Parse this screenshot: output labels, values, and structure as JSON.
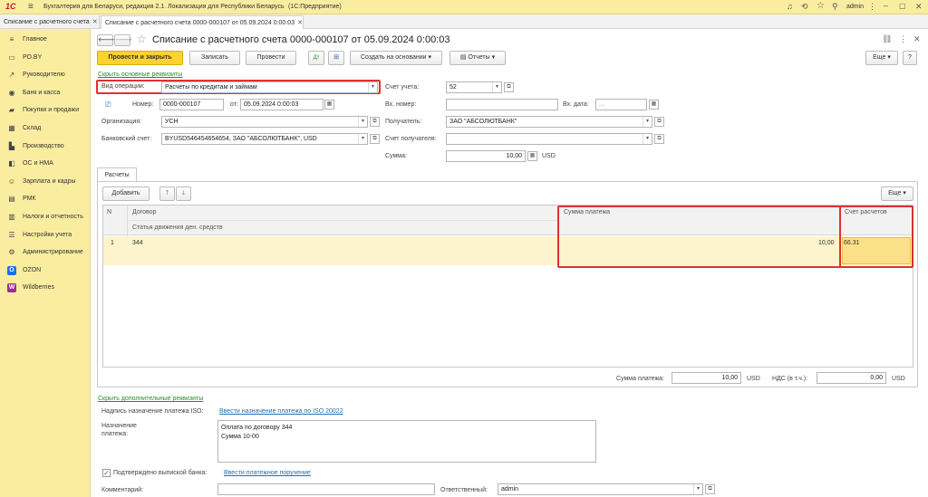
{
  "topbar": {
    "logo": "1С",
    "title": "Бухгалтерия для Беларуси, редакция 2.1. Локализация для Республики Беларусь",
    "platform": "(1С:Предприятие)",
    "user": "admin"
  },
  "tabs": [
    {
      "label": "Списание с расчетного счета"
    },
    {
      "label": "Списание с расчетного счета 0000-000107 от 05.09.2024 0:00:03"
    }
  ],
  "sidebar": {
    "items": [
      {
        "label": "Главное",
        "icon": "menu-icon",
        "glyph": "≡"
      },
      {
        "label": "РО.BY",
        "icon": "ro-icon",
        "glyph": "▭"
      },
      {
        "label": "Руководителю",
        "icon": "chart-icon",
        "glyph": "↗"
      },
      {
        "label": "Банк и касса",
        "icon": "bank-icon",
        "glyph": "◉"
      },
      {
        "label": "Покупки и продажи",
        "icon": "cart-icon",
        "glyph": "▰"
      },
      {
        "label": "Склад",
        "icon": "warehouse-icon",
        "glyph": "▦"
      },
      {
        "label": "Производство",
        "icon": "factory-icon",
        "glyph": "▙"
      },
      {
        "label": "ОС и НМА",
        "icon": "assets-icon",
        "glyph": "◧"
      },
      {
        "label": "Зарплата и кадры",
        "icon": "people-icon",
        "glyph": "☺"
      },
      {
        "label": "РМК",
        "icon": "cash-register-icon",
        "glyph": "▤"
      },
      {
        "label": "Налоги и отчетность",
        "icon": "taxes-icon",
        "glyph": "▥"
      },
      {
        "label": "Настройки учета",
        "icon": "settings-icon",
        "glyph": "☰"
      },
      {
        "label": "Администрирование",
        "icon": "gear-icon",
        "glyph": "⚙"
      },
      {
        "label": "OZON",
        "icon": "ozon-icon",
        "glyph": "O"
      },
      {
        "label": "Wildberries",
        "icon": "wildberries-icon",
        "glyph": "W"
      }
    ]
  },
  "doc": {
    "title": "Списание с расчетного счета 0000-000107 от 05.09.2024 0:00:03"
  },
  "toolbar": {
    "post_close": "Провести и закрыть",
    "save": "Записать",
    "post": "Провести",
    "create_based": "Создать на основании",
    "reports": "Отчеты",
    "more": "Еще"
  },
  "form": {
    "hide_main_link": "Скрыть основные реквизиты",
    "operation_label": "Вид операции:",
    "operation_value": "Расчеты по кредитам и займам",
    "number_label": "Номер:",
    "number_value": "0000-000107",
    "from_label": "от:",
    "date_value": "05.09.2024  0:00:03",
    "org_label": "Организация:",
    "org_value": "УСН",
    "bank_account_label": "Банковский счет:",
    "bank_account_value": "BYUSD546454654654, ЗАО \"АБСОЛЮТБАНК\", USD",
    "account_label": "Счет учета:",
    "account_value": "52",
    "in_number_label": "Вх. номер:",
    "in_number_value": "",
    "in_date_label": "Вх. дата:",
    "in_date_value": " .  .",
    "recipient_label": "Получатель:",
    "recipient_value": "ЗАО \"АБСОЛЮТБАНК\"",
    "recipient_account_label": "Счет получателя:",
    "recipient_account_value": "",
    "sum_label": "Сумма:",
    "sum_value": "10,00",
    "currency": "USD"
  },
  "payments": {
    "tab_label": "Расчеты",
    "add": "Добавить",
    "more": "Еще",
    "columns": {
      "n": "N",
      "contract": "Договор",
      "cashflow": "Статья движения ден. средств",
      "amount": "Сумма платежа",
      "account": "Счет расчетов"
    },
    "rows": [
      {
        "n": "1",
        "contract": "344",
        "amount": "10,00",
        "account": "66.31"
      }
    ],
    "total_label": "Сумма платежа:",
    "total_value": "10,00",
    "total_currency": "USD",
    "vat_label": "НДС (в т.ч.):",
    "vat_value": "0,00",
    "vat_currency": "USD"
  },
  "extra": {
    "hide_extra_link": "Скрыть дополнительные реквизиты",
    "iso_label": "Надпись назначение платежа ISO:",
    "iso_link": "Ввести назначение платежа по ISO 20022",
    "purpose_label": "Назначение платежа:",
    "purpose_line1": "Оплата по договору 344",
    "purpose_line2": "Сумма 10-00",
    "confirmed_label": "Подтверждено выпиской банка:",
    "payment_order_link": "Ввести платежное поручение",
    "comment_label": "Комментарий:",
    "comment_value": "",
    "responsible_label": "Ответственный:",
    "responsible_value": "admin"
  },
  "colors": {
    "accent": "#fcd22f",
    "sidebar": "#fbeda0",
    "highlight": "#e03131",
    "link": "#1f6fb5"
  }
}
